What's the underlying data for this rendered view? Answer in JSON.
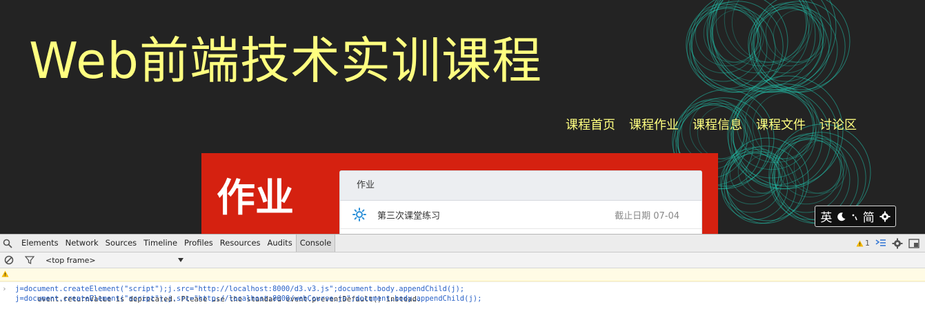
{
  "site": {
    "title": "Web前端技术实训课程",
    "nav": [
      "课程首页",
      "课程作业",
      "课程信息",
      "课程文件",
      "讨论区"
    ]
  },
  "homework": {
    "heading": "作业",
    "card_header": "作业",
    "items": [
      {
        "title": "第三次课堂练习",
        "deadline": "截止日期 07-04"
      }
    ]
  },
  "ime": {
    "lang": "英",
    "mode": "简"
  },
  "devtools": {
    "tabs": [
      "Elements",
      "Network",
      "Sources",
      "Timeline",
      "Profiles",
      "Resources",
      "Audits",
      "Console"
    ],
    "active_tab": "Console",
    "warning_count": "1",
    "frame": "<top frame>",
    "messages": {
      "warning": "event.returnValue is deprecated. Please use the standard event.preventDefault() instead.",
      "inputs": [
        "j=document.createElement(\"script\");j.src=\"http://localhost:8000/d3.v3.js\";document.body.appendChild(j);",
        "j=document.createElement(\"script\");j.src=\"http://localhost:8000/webCourse.js\";document.body.appendChild(j);"
      ]
    }
  },
  "colors": {
    "page_bg": "#232323",
    "title_yellow": "#ffff80",
    "panel_red": "#d52110",
    "deco_teal": "#22c7b0"
  }
}
